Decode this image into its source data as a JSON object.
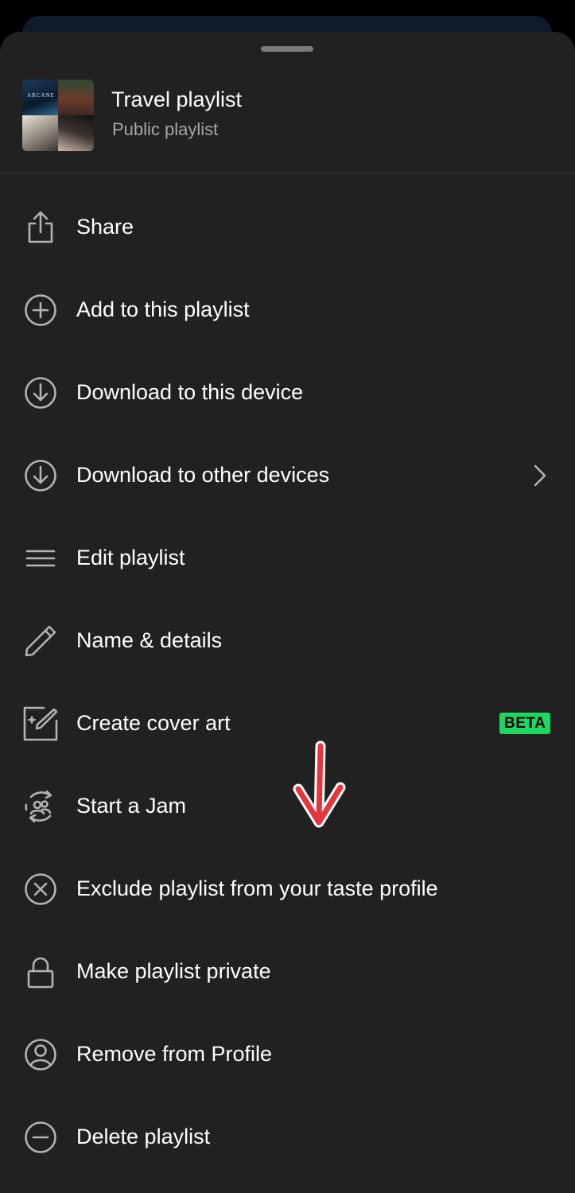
{
  "header": {
    "title": "Travel playlist",
    "subtitle": "Public playlist",
    "cover_text": "ARCANE"
  },
  "menu": [
    {
      "label": "Share",
      "icon": "share-icon"
    },
    {
      "label": "Add to this playlist",
      "icon": "add-circle-icon"
    },
    {
      "label": "Download to this device",
      "icon": "download-circle-icon"
    },
    {
      "label": "Download to other devices",
      "icon": "download-circle-icon",
      "trailing": "chevron-right-icon"
    },
    {
      "label": "Edit playlist",
      "icon": "menu-lines-icon"
    },
    {
      "label": "Name & details",
      "icon": "pencil-icon"
    },
    {
      "label": "Create cover art",
      "icon": "cover-art-icon",
      "badge": "BETA"
    },
    {
      "label": "Start a Jam",
      "icon": "jam-icon"
    },
    {
      "label": "Exclude playlist from your taste profile",
      "icon": "exclude-circle-icon"
    },
    {
      "label": "Make playlist private",
      "icon": "lock-icon"
    },
    {
      "label": "Remove from Profile",
      "icon": "profile-circle-icon"
    },
    {
      "label": "Delete playlist",
      "icon": "minus-circle-icon"
    }
  ],
  "colors": {
    "sheet_bg": "#212121",
    "text_primary": "#ffffff",
    "text_secondary": "#a7a7a7",
    "accent_green": "#1ed760",
    "annotation_red": "#e8343b"
  }
}
